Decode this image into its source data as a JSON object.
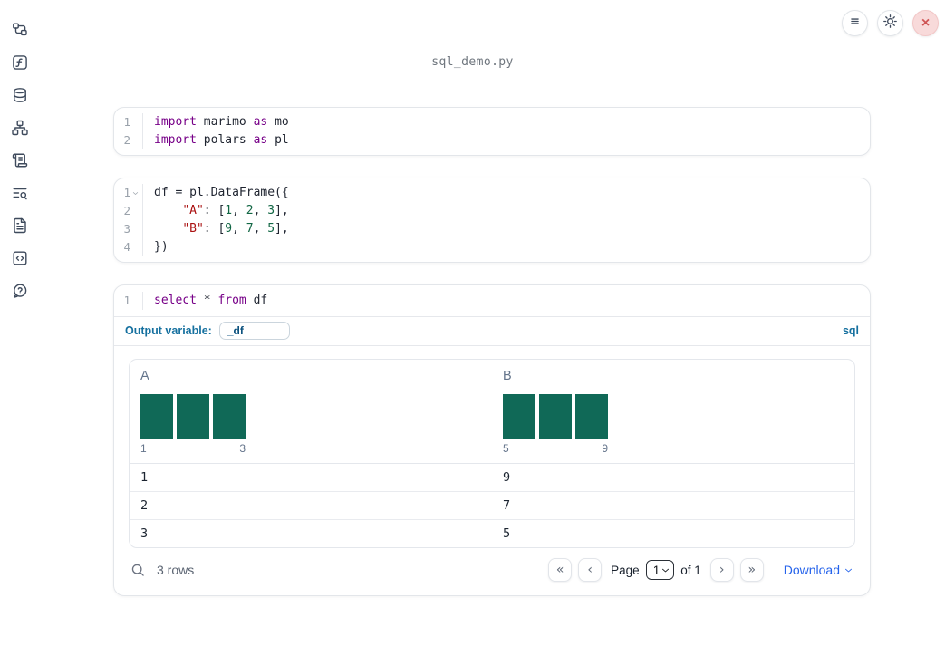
{
  "window": {
    "title": "sql_demo.py"
  },
  "topbar": {
    "buttons": [
      {
        "name": "notebook-menu",
        "icon": "menu-icon"
      },
      {
        "name": "settings",
        "icon": "gear-icon"
      },
      {
        "name": "shutdown",
        "icon": "close-icon",
        "close_glyph": "×"
      }
    ]
  },
  "sidebar": {
    "items": [
      {
        "name": "file-explorer",
        "icon": "file-tree-icon"
      },
      {
        "name": "functions",
        "icon": "function-icon"
      },
      {
        "name": "datasources",
        "icon": "database-icon"
      },
      {
        "name": "dependency-graph",
        "icon": "graph-icon"
      },
      {
        "name": "logs",
        "icon": "scroll-icon"
      },
      {
        "name": "variables-search",
        "icon": "text-search-icon"
      },
      {
        "name": "documentation",
        "icon": "file-text-icon"
      },
      {
        "name": "snippets",
        "icon": "code-square-icon"
      },
      {
        "name": "help",
        "icon": "help-circle-icon"
      }
    ]
  },
  "code_cells": [
    {
      "lines": [
        {
          "n": "1",
          "fold": false,
          "tokens": [
            [
              "kw",
              "import"
            ],
            [
              "pl",
              " marimo "
            ],
            [
              "kw",
              "as"
            ],
            [
              "pl",
              " mo"
            ]
          ]
        },
        {
          "n": "2",
          "fold": false,
          "tokens": [
            [
              "kw",
              "import"
            ],
            [
              "pl",
              " polars "
            ],
            [
              "kw",
              "as"
            ],
            [
              "pl",
              " pl"
            ]
          ]
        }
      ]
    },
    {
      "lines": [
        {
          "n": "1",
          "fold": true,
          "tokens": [
            [
              "pl",
              "df = pl.DataFrame({"
            ]
          ]
        },
        {
          "n": "2",
          "fold": false,
          "tokens": [
            [
              "pl",
              "    "
            ],
            [
              "str",
              "\"A\""
            ],
            [
              "pl",
              ": ["
            ],
            [
              "num",
              "1"
            ],
            [
              "pl",
              ", "
            ],
            [
              "num",
              "2"
            ],
            [
              "pl",
              ", "
            ],
            [
              "num",
              "3"
            ],
            [
              "pl",
              "],"
            ]
          ]
        },
        {
          "n": "3",
          "fold": false,
          "tokens": [
            [
              "pl",
              "    "
            ],
            [
              "str",
              "\"B\""
            ],
            [
              "pl",
              ": ["
            ],
            [
              "num",
              "9"
            ],
            [
              "pl",
              ", "
            ],
            [
              "num",
              "7"
            ],
            [
              "pl",
              ", "
            ],
            [
              "num",
              "5"
            ],
            [
              "pl",
              "],"
            ]
          ]
        },
        {
          "n": "4",
          "fold": false,
          "tokens": [
            [
              "pl",
              "})"
            ]
          ]
        }
      ]
    },
    {
      "lines": [
        {
          "n": "1",
          "fold": false,
          "tokens": [
            [
              "kw",
              "select"
            ],
            [
              "pl",
              " * "
            ],
            [
              "kw",
              "from"
            ],
            [
              "pl",
              " df"
            ]
          ]
        }
      ]
    }
  ],
  "sql_cell": {
    "output_variable_label": "Output variable:",
    "output_variable_value": "_df",
    "language_label": "sql"
  },
  "table": {
    "columns": [
      {
        "header": "A",
        "histogram": {
          "bars": [
            1,
            1,
            1
          ],
          "min_label": "1",
          "max_label": "3"
        }
      },
      {
        "header": "B",
        "histogram": {
          "bars": [
            1,
            1,
            1
          ],
          "min_label": "5",
          "max_label": "9"
        }
      }
    ],
    "rows": [
      [
        "1",
        "9"
      ],
      [
        "2",
        "7"
      ],
      [
        "3",
        "5"
      ]
    ],
    "footer": {
      "rows_count": "3 rows",
      "page_label": "Page",
      "page_value": "1",
      "page_total_label": "of 1",
      "download_label": "Download",
      "pagination": {
        "first": "«",
        "prev": "‹",
        "next": "›",
        "last": "»"
      }
    }
  },
  "colors": {
    "accent_blue": "#15709f",
    "keyword": "#770088",
    "string": "#aa1111",
    "number": "#116644",
    "histogram_bar": "#106957",
    "download_link": "#2563eb",
    "close_button_bg": "#f8dada",
    "close_button_fg": "#cf5454"
  }
}
